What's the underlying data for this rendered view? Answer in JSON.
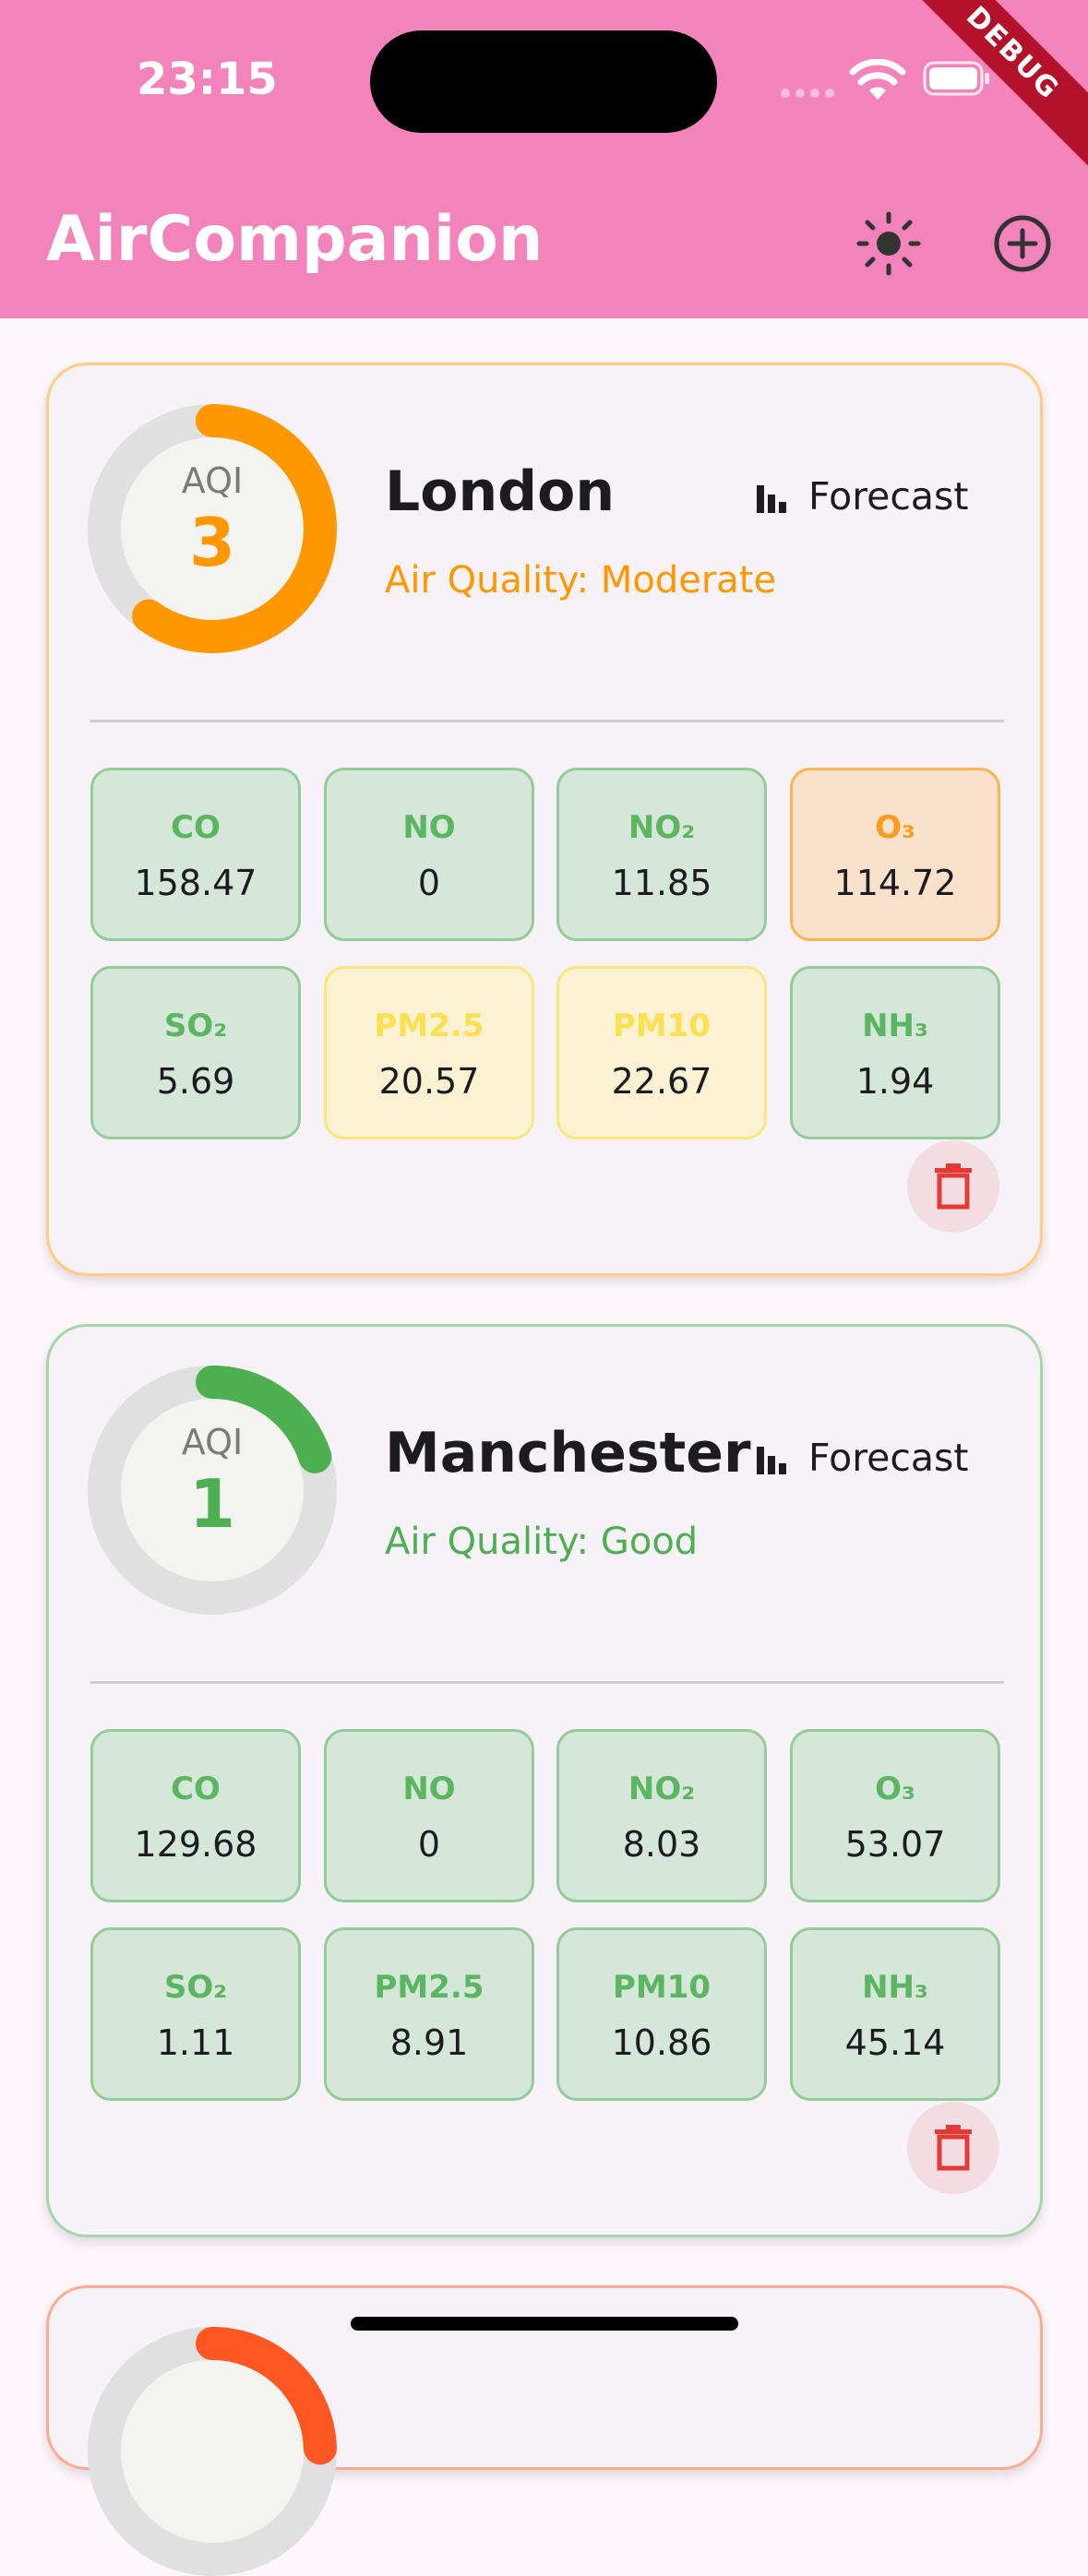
{
  "status_bar": {
    "time": "23:15"
  },
  "debug_banner": "DEBUG",
  "app_bar": {
    "title": "AirCompanion",
    "brightness_icon": "brightness-icon",
    "add_icon": "add-circle-icon"
  },
  "colors": {
    "app_bar": "#f283bb",
    "moderate": "#ff9800",
    "good": "#4caf50",
    "poor": "#ff5722",
    "fair": "#ffeb3b",
    "delete": "#e53935"
  },
  "cards": [
    {
      "city": "London",
      "aqi_label": "AQI",
      "aqi": "3",
      "aqi_fraction": 0.6,
      "quality": "Air Quality: Moderate",
      "forecast_label": "Forecast",
      "pollutants": [
        {
          "name": "CO",
          "value": "158.47",
          "level": "green"
        },
        {
          "name": "NO",
          "value": "0",
          "level": "green"
        },
        {
          "name": "NO₂",
          "value": "11.85",
          "level": "green"
        },
        {
          "name": "O₃",
          "value": "114.72",
          "level": "orange"
        },
        {
          "name": "SO₂",
          "value": "5.69",
          "level": "green"
        },
        {
          "name": "PM2.5",
          "value": "20.57",
          "level": "yellow"
        },
        {
          "name": "PM10",
          "value": "22.67",
          "level": "yellow"
        },
        {
          "name": "NH₃",
          "value": "1.94",
          "level": "green"
        }
      ]
    },
    {
      "city": "Manchester",
      "aqi_label": "AQI",
      "aqi": "1",
      "aqi_fraction": 0.2,
      "quality": "Air Quality: Good",
      "forecast_label": "Forecast",
      "pollutants": [
        {
          "name": "CO",
          "value": "129.68",
          "level": "green"
        },
        {
          "name": "NO",
          "value": "0",
          "level": "green"
        },
        {
          "name": "NO₂",
          "value": "8.03",
          "level": "green"
        },
        {
          "name": "O₃",
          "value": "53.07",
          "level": "green"
        },
        {
          "name": "SO₂",
          "value": "1.11",
          "level": "green"
        },
        {
          "name": "PM2.5",
          "value": "8.91",
          "level": "green"
        },
        {
          "name": "PM10",
          "value": "10.86",
          "level": "green"
        },
        {
          "name": "NH₃",
          "value": "45.14",
          "level": "green"
        }
      ]
    }
  ]
}
